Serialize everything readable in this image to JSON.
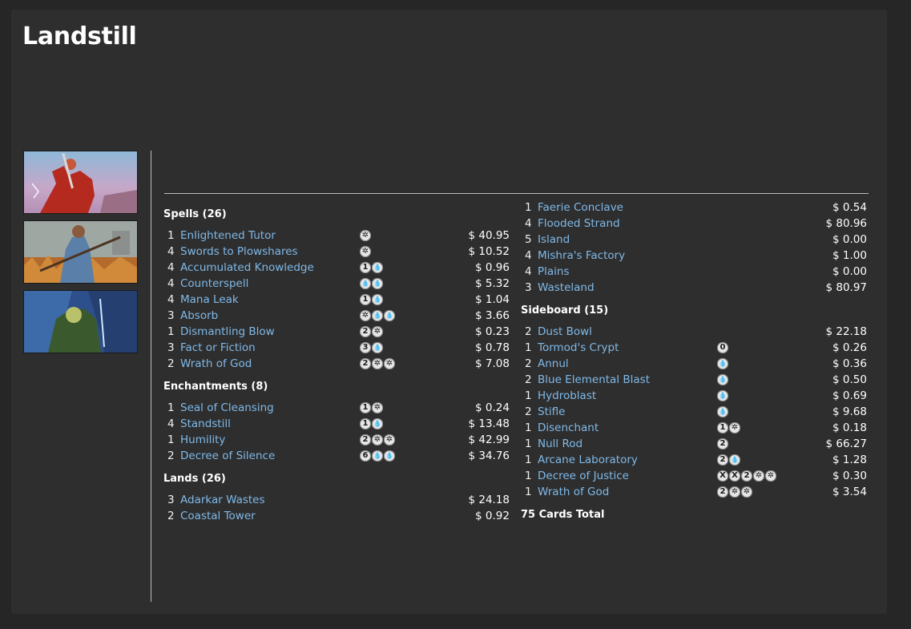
{
  "deck": {
    "title": "Landstill"
  },
  "images": [
    {
      "alt": "red-armored warrior art"
    },
    {
      "alt": "farmer in field art"
    },
    {
      "alt": "blue wizard art"
    }
  ],
  "symbols": {
    "W": "✲",
    "U": "💧"
  },
  "left_sections": [
    {
      "title": "Spells (26)",
      "cards": [
        {
          "qty": "1",
          "name": "Enlightened Tutor",
          "cost": [
            "W"
          ],
          "price": "$ 40.95"
        },
        {
          "qty": "4",
          "name": "Swords to Plowshares",
          "cost": [
            "W"
          ],
          "price": "$ 10.52"
        },
        {
          "qty": "4",
          "name": "Accumulated Knowledge",
          "cost": [
            "1",
            "U"
          ],
          "price": "$ 0.96"
        },
        {
          "qty": "4",
          "name": "Counterspell",
          "cost": [
            "U",
            "U"
          ],
          "price": "$ 5.32"
        },
        {
          "qty": "4",
          "name": "Mana Leak",
          "cost": [
            "1",
            "U"
          ],
          "price": "$ 1.04"
        },
        {
          "qty": "3",
          "name": "Absorb",
          "cost": [
            "W",
            "U",
            "U"
          ],
          "price": "$ 3.66"
        },
        {
          "qty": "1",
          "name": "Dismantling Blow",
          "cost": [
            "2",
            "W"
          ],
          "price": "$ 0.23"
        },
        {
          "qty": "3",
          "name": "Fact or Fiction",
          "cost": [
            "3",
            "U"
          ],
          "price": "$ 0.78"
        },
        {
          "qty": "2",
          "name": "Wrath of God",
          "cost": [
            "2",
            "W",
            "W"
          ],
          "price": "$ 7.08"
        }
      ]
    },
    {
      "title": "Enchantments (8)",
      "cards": [
        {
          "qty": "1",
          "name": "Seal of Cleansing",
          "cost": [
            "1",
            "W"
          ],
          "price": "$ 0.24"
        },
        {
          "qty": "4",
          "name": "Standstill",
          "cost": [
            "1",
            "U"
          ],
          "price": "$ 13.48"
        },
        {
          "qty": "1",
          "name": "Humility",
          "cost": [
            "2",
            "W",
            "W"
          ],
          "price": "$ 42.99"
        },
        {
          "qty": "2",
          "name": "Decree of Silence",
          "cost": [
            "6",
            "U",
            "U"
          ],
          "price": "$ 34.76"
        }
      ]
    },
    {
      "title": "Lands (26)",
      "cards": [
        {
          "qty": "3",
          "name": "Adarkar Wastes",
          "cost": [],
          "price": "$ 24.18"
        },
        {
          "qty": "2",
          "name": "Coastal Tower",
          "cost": [],
          "price": "$ 0.92"
        }
      ]
    }
  ],
  "lands_continued": [
    {
      "qty": "1",
      "name": "Faerie Conclave",
      "cost": [],
      "price": "$ 0.54"
    },
    {
      "qty": "4",
      "name": "Flooded Strand",
      "cost": [],
      "price": "$ 80.96"
    },
    {
      "qty": "5",
      "name": "Island",
      "cost": [],
      "price": "$ 0.00"
    },
    {
      "qty": "4",
      "name": "Mishra's Factory",
      "cost": [],
      "price": "$ 1.00"
    },
    {
      "qty": "4",
      "name": "Plains",
      "cost": [],
      "price": "$ 0.00"
    },
    {
      "qty": "3",
      "name": "Wasteland",
      "cost": [],
      "price": "$ 80.97"
    }
  ],
  "sideboard": {
    "title": "Sideboard (15)",
    "cards": [
      {
        "qty": "2",
        "name": "Dust Bowl",
        "cost": [],
        "price": "$ 22.18"
      },
      {
        "qty": "1",
        "name": "Tormod's Crypt",
        "cost": [
          "0"
        ],
        "price": "$ 0.26"
      },
      {
        "qty": "2",
        "name": "Annul",
        "cost": [
          "U"
        ],
        "price": "$ 0.36"
      },
      {
        "qty": "2",
        "name": "Blue Elemental Blast",
        "cost": [
          "U"
        ],
        "price": "$ 0.50"
      },
      {
        "qty": "1",
        "name": "Hydroblast",
        "cost": [
          "U"
        ],
        "price": "$ 0.69"
      },
      {
        "qty": "2",
        "name": "Stifle",
        "cost": [
          "U"
        ],
        "price": "$ 9.68"
      },
      {
        "qty": "1",
        "name": "Disenchant",
        "cost": [
          "1",
          "W"
        ],
        "price": "$ 0.18"
      },
      {
        "qty": "1",
        "name": "Null Rod",
        "cost": [
          "2"
        ],
        "price": "$ 66.27"
      },
      {
        "qty": "1",
        "name": "Arcane Laboratory",
        "cost": [
          "2",
          "U"
        ],
        "price": "$ 1.28"
      },
      {
        "qty": "1",
        "name": "Decree of Justice",
        "cost": [
          "X",
          "X",
          "2",
          "W",
          "W"
        ],
        "price": "$ 0.30"
      },
      {
        "qty": "1",
        "name": "Wrath of God",
        "cost": [
          "2",
          "W",
          "W"
        ],
        "price": "$ 3.54"
      }
    ]
  },
  "total": "75 Cards Total"
}
